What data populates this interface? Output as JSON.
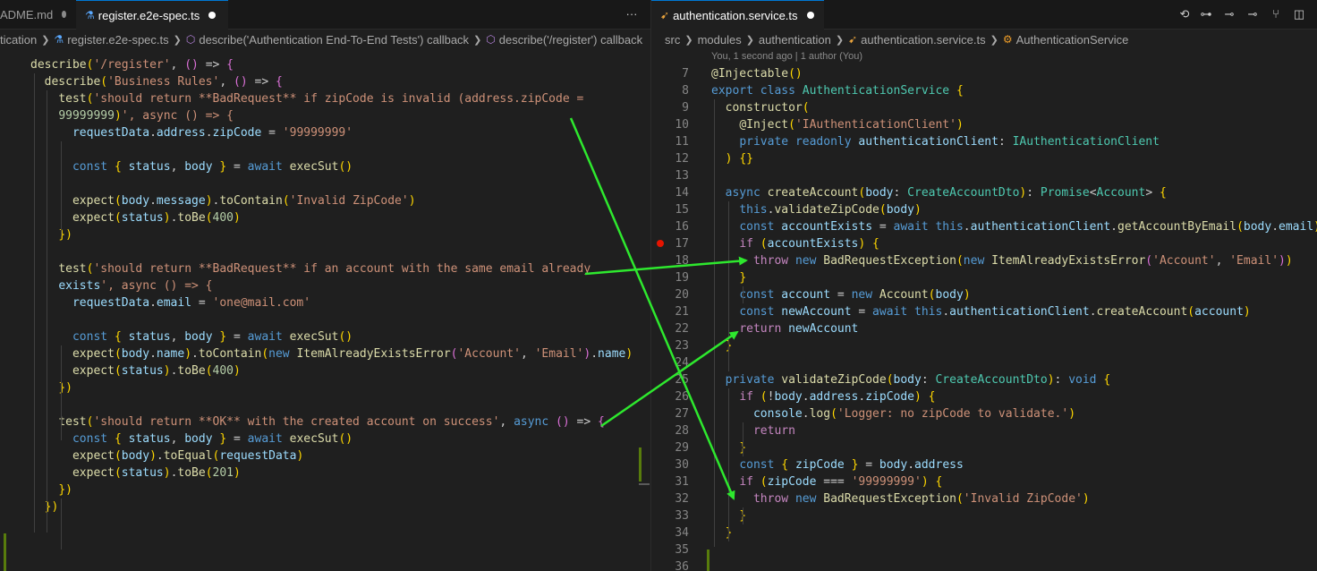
{
  "left_editor": {
    "tabs": [
      {
        "label": "ADME.md",
        "modified": true,
        "active": false
      },
      {
        "label": "register.e2e-spec.ts",
        "modified": true,
        "active": true
      }
    ],
    "more_actions_icon": "ellipsis-icon",
    "breadcrumb": [
      "tication",
      "register.e2e-spec.ts",
      "describe('Authentication End-To-End Tests') callback",
      "describe('/register') callback"
    ],
    "lines": [
      "describe('/register', () => {",
      "  describe('Business Rules', () => {",
      "    test('should return **BadRequest** if zipCode is invalid (address.zipCode =",
      "    99999999)', async () => {",
      "      requestData.address.zipCode = '99999999'",
      "",
      "      const { status, body } = await execSut()",
      "",
      "      expect(body.message).toContain('Invalid ZipCode')",
      "      expect(status).toBe(400)",
      "    })",
      "",
      "    test('should return **BadRequest** if an account with the same email already",
      "    exists', async () => {",
      "      requestData.email = 'one@mail.com'",
      "",
      "      const { status, body } = await execSut()",
      "      expect(body.name).toContain(new ItemAlreadyExistsError('Account', 'Email').name)",
      "      expect(status).toBe(400)",
      "    })",
      "",
      "    test('should return **OK** with the created account on success', async () => {",
      "      const { status, body } = await execSut()",
      "      expect(body).toEqual(requestData)",
      "      expect(status).toBe(201)",
      "    })",
      "  })"
    ]
  },
  "right_editor": {
    "tab": {
      "label": "authentication.service.ts",
      "modified": true,
      "active": true
    },
    "toolbar_icons": [
      "history-icon",
      "git-commit-icon",
      "git-compare-icon",
      "git-compare-icon",
      "git-branch-icon",
      "split-editor-icon"
    ],
    "breadcrumb": [
      "src",
      "modules",
      "authentication",
      "authentication.service.ts",
      "AuthenticationService"
    ],
    "codelens": "You, 1 second ago | 1 author (You)",
    "line_numbers": [
      7,
      8,
      9,
      10,
      11,
      12,
      13,
      14,
      15,
      16,
      17,
      18,
      19,
      20,
      21,
      22,
      23,
      24,
      25,
      26,
      27,
      28,
      29,
      30,
      31,
      32,
      33,
      34,
      35,
      36
    ],
    "breakpoint_line": 17,
    "lines": [
      "@Injectable()",
      "export class AuthenticationService {",
      "  constructor(",
      "    @Inject('IAuthenticationClient')",
      "    private readonly authenticationClient: IAuthenticationClient",
      "  ) {}",
      "",
      "  async createAccount(body: CreateAccountDto): Promise<Account> {",
      "    this.validateZipCode(body)",
      "    const accountExists = await this.authenticationClient.getAccountByEmail(body.email)",
      "    if (accountExists) {",
      "      throw new BadRequestException(new ItemAlreadyExistsError('Account', 'Email'))",
      "    }",
      "    const account = new Account(body)",
      "    const newAccount = await this.authenticationClient.createAccount(account)",
      "    return newAccount",
      "  }",
      "",
      "  private validateZipCode(body: CreateAccountDto): void {",
      "    if (!body.address.zipCode) {",
      "      console.log('Logger: no zipCode to validate.')",
      "      return",
      "    }",
      "    const { zipCode } = body.address",
      "    if (zipCode === '99999999') {",
      "      throw new BadRequestException('Invalid ZipCode')",
      "    }",
      "  }",
      "",
      ""
    ]
  },
  "colors": {
    "background": "#1f1f1f",
    "arrow": "#2ee82e",
    "breakpoint": "#e51400",
    "keyword": "#569cd6",
    "control": "#c586c0",
    "string": "#ce9178",
    "function": "#dcdcaa",
    "variable": "#9cdcfe",
    "type": "#4ec9b0",
    "number": "#b5cea8"
  }
}
